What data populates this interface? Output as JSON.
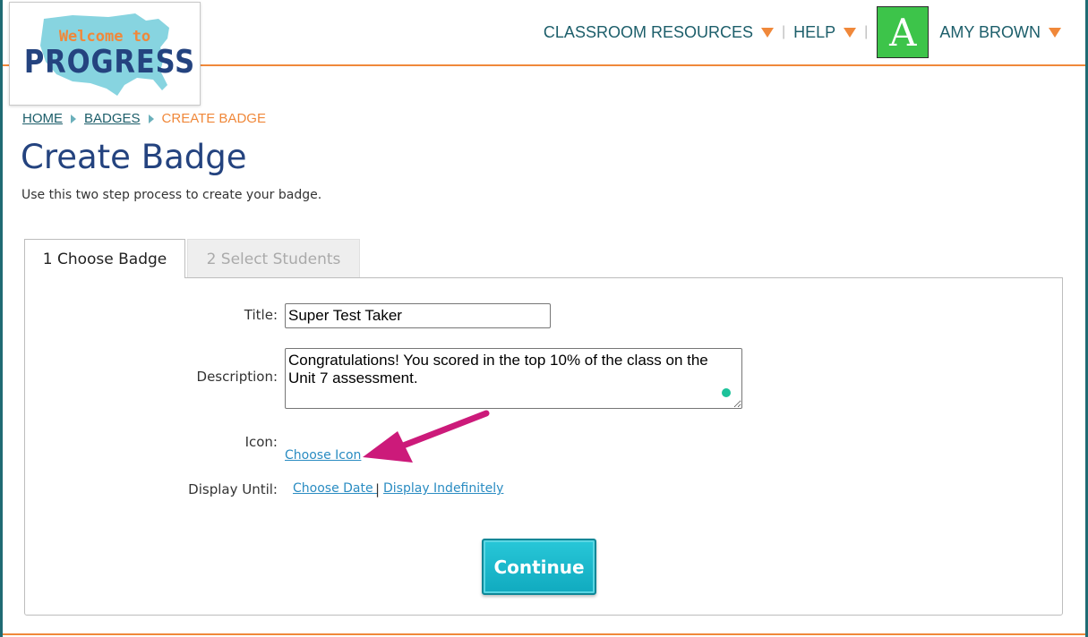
{
  "brand": {
    "logo_line1": "Welcome to",
    "logo_line2": "PROGRESS"
  },
  "topnav": {
    "classroom_resources": "CLASSROOM RESOURCES",
    "help": "HELP",
    "separator": "|",
    "avatar_letter": "A",
    "user_name": "AMY BROWN"
  },
  "breadcrumb": {
    "home": "HOME",
    "badges": "BADGES",
    "current": "CREATE BADGE"
  },
  "page": {
    "title": "Create Badge",
    "subtitle": "Use this two step process to create your badge."
  },
  "tabs": [
    {
      "label": "1 Choose Badge",
      "active": true
    },
    {
      "label": "2 Select Students",
      "active": false
    }
  ],
  "form": {
    "title_label": "Title:",
    "title_value": "Super Test Taker",
    "description_label": "Description:",
    "description_value": "Congratulations! You scored in the top 10% of the class on the Unit 7 assessment.",
    "icon_label": "Icon:",
    "choose_icon": "Choose Icon",
    "display_until_label": "Display Until:",
    "choose_date": "Choose Date ",
    "separator": "|",
    "display_indefinitely": "Display Indefinitely"
  },
  "buttons": {
    "continue": "Continue"
  },
  "colors": {
    "accent_orange": "#f0883a",
    "title_navy": "#24437f",
    "nav_teal": "#1c5e6a",
    "link_blue": "#2a8cc2",
    "button_teal": "#10aabf",
    "avatar_green": "#3dc44a",
    "annotation_magenta": "#cc1a7a"
  }
}
